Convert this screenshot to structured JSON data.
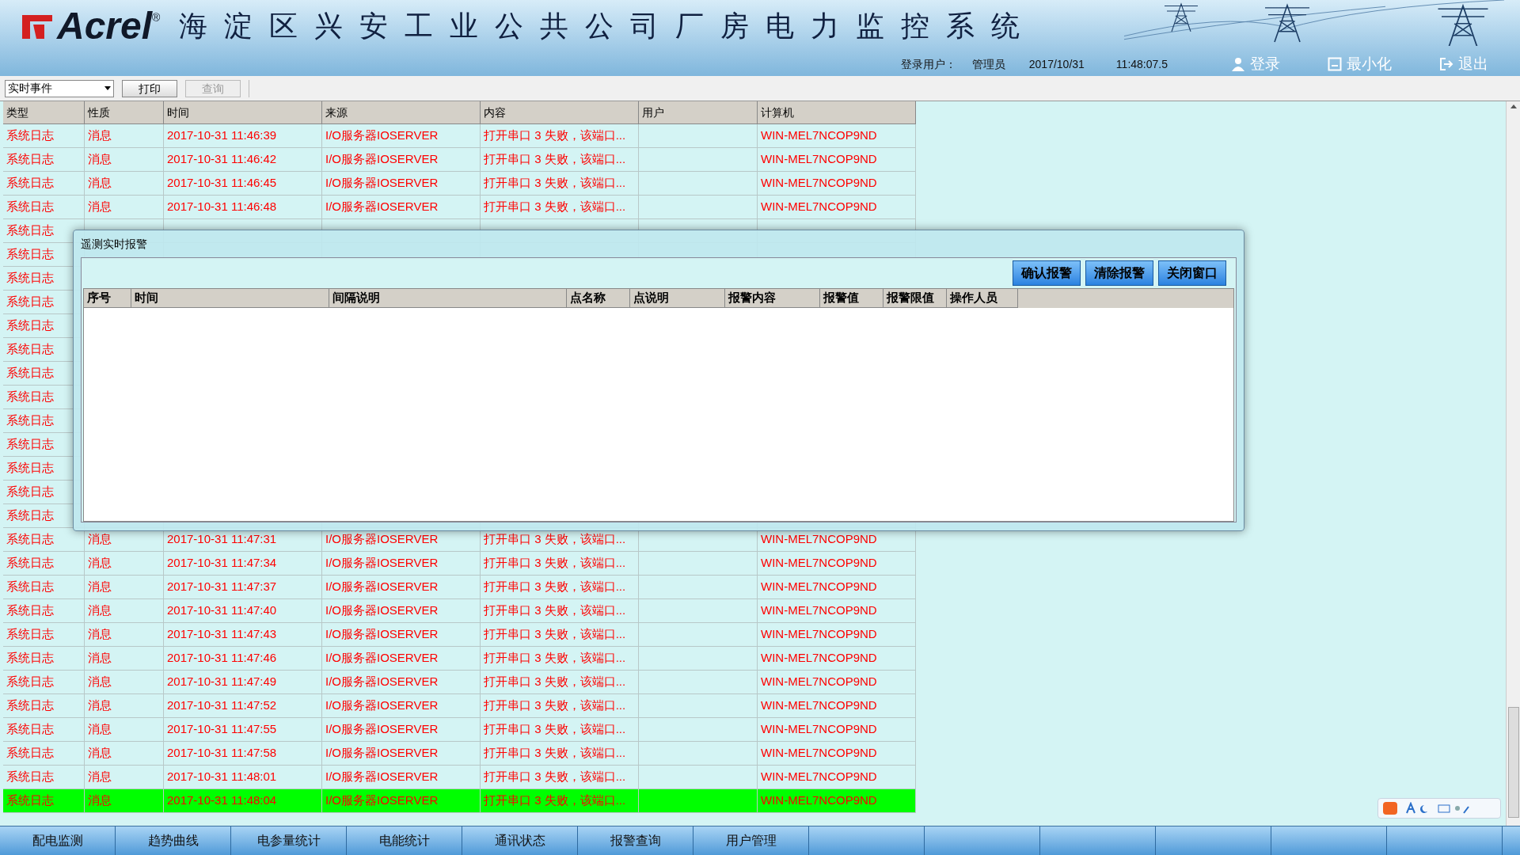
{
  "header": {
    "logo": "Acrel",
    "logo_mark": "®",
    "title": "海淀区兴安工业公共公司厂房电力监控系统",
    "user_label": "登录用户：",
    "user": "管理员",
    "date": "2017/10/31",
    "time": "11:48:07.5",
    "buttons": [
      "登录",
      "最小化",
      "退出"
    ]
  },
  "toolbar": {
    "select": "实时事件",
    "buttons": [
      {
        "label": "打印",
        "disabled": false
      },
      {
        "label": "查询",
        "disabled": true
      }
    ]
  },
  "table": {
    "columns": [
      "类型",
      "性质",
      "时间",
      "来源",
      "内容",
      "用户",
      "计算机"
    ],
    "rows": [
      {
        "cells": [
          "系统日志",
          "消息",
          "2017-10-31 11:46:39",
          "I/O服务器IOSERVER",
          "打开串口 3 失败，该端口...",
          "",
          "WIN-MEL7NCOP9ND"
        ],
        "selected": false
      },
      {
        "cells": [
          "系统日志",
          "消息",
          "2017-10-31 11:46:42",
          "I/O服务器IOSERVER",
          "打开串口 3 失败，该端口...",
          "",
          "WIN-MEL7NCOP9ND"
        ],
        "selected": false
      },
      {
        "cells": [
          "系统日志",
          "消息",
          "2017-10-31 11:46:45",
          "I/O服务器IOSERVER",
          "打开串口 3 失败，该端口...",
          "",
          "WIN-MEL7NCOP9ND"
        ],
        "selected": false
      },
      {
        "cells": [
          "系统日志",
          "消息",
          "2017-10-31 11:46:48",
          "I/O服务器IOSERVER",
          "打开串口 3 失败，该端口...",
          "",
          "WIN-MEL7NCOP9ND"
        ],
        "selected": false
      },
      {
        "cells": [
          "系统日志"
        ],
        "selected": false
      },
      {
        "cells": [
          "系统日志"
        ],
        "selected": false
      },
      {
        "cells": [
          "系统日志"
        ],
        "selected": false
      },
      {
        "cells": [
          "系统日志"
        ],
        "selected": false
      },
      {
        "cells": [
          "系统日志"
        ],
        "selected": false
      },
      {
        "cells": [
          "系统日志"
        ],
        "selected": false
      },
      {
        "cells": [
          "系统日志"
        ],
        "selected": false
      },
      {
        "cells": [
          "系统日志"
        ],
        "selected": false
      },
      {
        "cells": [
          "系统日志"
        ],
        "selected": false
      },
      {
        "cells": [
          "系统日志"
        ],
        "selected": false
      },
      {
        "cells": [
          "系统日志"
        ],
        "selected": false
      },
      {
        "cells": [
          "系统日志"
        ],
        "selected": false
      },
      {
        "cells": [
          "系统日志"
        ],
        "selected": false
      },
      {
        "cells": [
          "系统日志",
          "消息",
          "2017-10-31 11:47:31",
          "I/O服务器IOSERVER",
          "打开串口 3 失败，该端口...",
          "",
          "WIN-MEL7NCOP9ND"
        ],
        "selected": false
      },
      {
        "cells": [
          "系统日志",
          "消息",
          "2017-10-31 11:47:34",
          "I/O服务器IOSERVER",
          "打开串口 3 失败，该端口...",
          "",
          "WIN-MEL7NCOP9ND"
        ],
        "selected": false
      },
      {
        "cells": [
          "系统日志",
          "消息",
          "2017-10-31 11:47:37",
          "I/O服务器IOSERVER",
          "打开串口 3 失败，该端口...",
          "",
          "WIN-MEL7NCOP9ND"
        ],
        "selected": false
      },
      {
        "cells": [
          "系统日志",
          "消息",
          "2017-10-31 11:47:40",
          "I/O服务器IOSERVER",
          "打开串口 3 失败，该端口...",
          "",
          "WIN-MEL7NCOP9ND"
        ],
        "selected": false
      },
      {
        "cells": [
          "系统日志",
          "消息",
          "2017-10-31 11:47:43",
          "I/O服务器IOSERVER",
          "打开串口 3 失败，该端口...",
          "",
          "WIN-MEL7NCOP9ND"
        ],
        "selected": false
      },
      {
        "cells": [
          "系统日志",
          "消息",
          "2017-10-31 11:47:46",
          "I/O服务器IOSERVER",
          "打开串口 3 失败，该端口...",
          "",
          "WIN-MEL7NCOP9ND"
        ],
        "selected": false
      },
      {
        "cells": [
          "系统日志",
          "消息",
          "2017-10-31 11:47:49",
          "I/O服务器IOSERVER",
          "打开串口 3 失败，该端口...",
          "",
          "WIN-MEL7NCOP9ND"
        ],
        "selected": false
      },
      {
        "cells": [
          "系统日志",
          "消息",
          "2017-10-31 11:47:52",
          "I/O服务器IOSERVER",
          "打开串口 3 失败，该端口...",
          "",
          "WIN-MEL7NCOP9ND"
        ],
        "selected": false
      },
      {
        "cells": [
          "系统日志",
          "消息",
          "2017-10-31 11:47:55",
          "I/O服务器IOSERVER",
          "打开串口 3 失败，该端口...",
          "",
          "WIN-MEL7NCOP9ND"
        ],
        "selected": false
      },
      {
        "cells": [
          "系统日志",
          "消息",
          "2017-10-31 11:47:58",
          "I/O服务器IOSERVER",
          "打开串口 3 失败，该端口...",
          "",
          "WIN-MEL7NCOP9ND"
        ],
        "selected": false
      },
      {
        "cells": [
          "系统日志",
          "消息",
          "2017-10-31 11:48:01",
          "I/O服务器IOSERVER",
          "打开串口 3 失败，该端口...",
          "",
          "WIN-MEL7NCOP9ND"
        ],
        "selected": false
      },
      {
        "cells": [
          "系统日志",
          "消息",
          "2017-10-31 11:48:04",
          "I/O服务器IOSERVER",
          "打开串口 3 失败，该端口...",
          "",
          "WIN-MEL7NCOP9ND"
        ],
        "selected": true
      }
    ]
  },
  "dialog": {
    "title": "遥测实时报警",
    "buttons": [
      "确认报警",
      "清除报警",
      "关闭窗口"
    ],
    "columns": [
      "序号",
      "时间",
      "间隔说明",
      "点名称",
      "点说明",
      "报警内容",
      "报警值",
      "报警限值",
      "操作人员"
    ]
  },
  "bottom_tabs": [
    "配电监测",
    "趋势曲线",
    "电参量统计",
    "电能统计",
    "通讯状态",
    "报警查询",
    "用户管理"
  ]
}
